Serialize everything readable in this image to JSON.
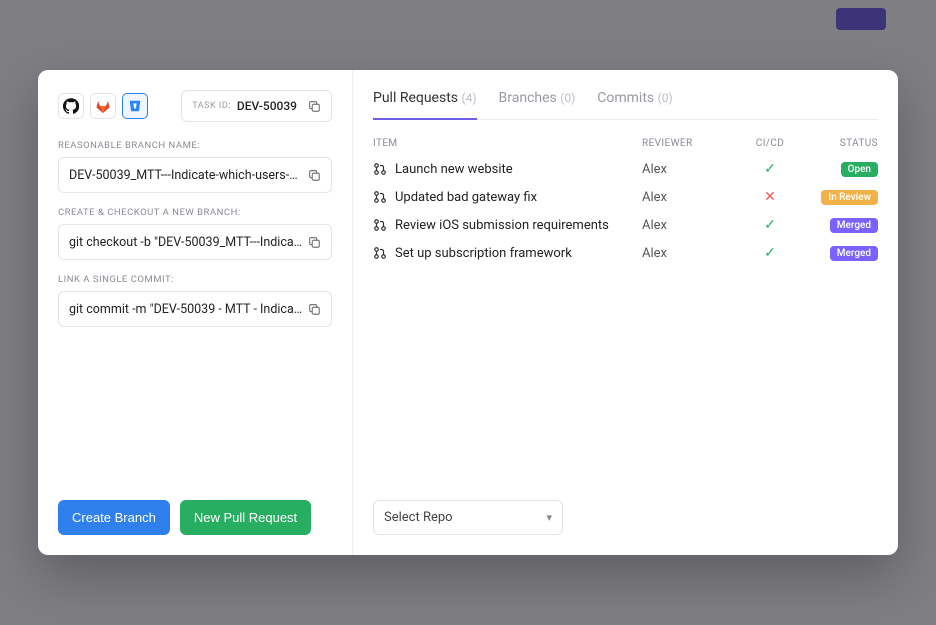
{
  "task": {
    "id_label": "TASK ID:",
    "id_value": "DEV-50039"
  },
  "fields": {
    "branch_label": "REASONABLE BRANCH NAME:",
    "branch_value": "DEV-50039_MTT---Indicate-which-users-c...",
    "checkout_label": "CREATE & CHECKOUT A NEW BRANCH:",
    "checkout_value": "git checkout -b \"DEV-50039_MTT---Indica...",
    "commit_label": "LINK A SINGLE COMMIT:",
    "commit_value": "git commit -m \"DEV-50039 - MTT - Indicat..."
  },
  "buttons": {
    "create_branch": "Create Branch",
    "new_pull_request": "New Pull Request"
  },
  "tabs": {
    "pull_requests": {
      "label": "Pull Requests",
      "count": "(4)"
    },
    "branches": {
      "label": "Branches",
      "count": "(0)"
    },
    "commits": {
      "label": "Commits",
      "count": "(0)"
    }
  },
  "columns": {
    "item": "ITEM",
    "reviewer": "REVIEWER",
    "cicd": "CI/CD",
    "status": "STATUS"
  },
  "pull_requests": [
    {
      "title": "Launch new website",
      "reviewer": "Alex",
      "ci": "ok",
      "status": "Open",
      "status_class": "badge-open"
    },
    {
      "title": "Updated bad gateway fix",
      "reviewer": "Alex",
      "ci": "fail",
      "status": "In Review",
      "status_class": "badge-review"
    },
    {
      "title": "Review iOS submission requirements",
      "reviewer": "Alex",
      "ci": "ok",
      "status": "Merged",
      "status_class": "badge-merged"
    },
    {
      "title": "Set up subscription framework",
      "reviewer": "Alex",
      "ci": "ok",
      "status": "Merged",
      "status_class": "badge-merged"
    }
  ],
  "repo_select": "Select Repo",
  "checkmark": "✓",
  "cross": "✕"
}
